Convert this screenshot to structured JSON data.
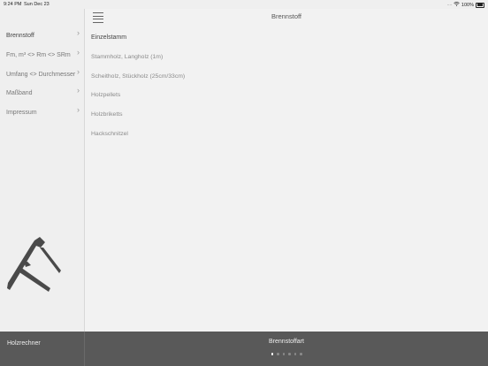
{
  "statusbar": {
    "time": "9:24 PM",
    "date": "Sun Dec 23",
    "battery": "100%",
    "icons": [
      "signal-icon",
      "wifi-icon",
      "battery-icon"
    ]
  },
  "sidebar": {
    "items": [
      {
        "label": "Brennstoff",
        "active": true
      },
      {
        "label": "Fm, m³ <> Rm <> SRm",
        "active": false
      },
      {
        "label": "Umfang <> Durchmesser",
        "active": false
      },
      {
        "label": "Maßband",
        "active": false
      },
      {
        "label": "Impressum",
        "active": false
      }
    ],
    "logo": "caliper-logo"
  },
  "main": {
    "title": "Brennstoff",
    "header": "Einzelstamm",
    "items": [
      "Stammholz, Langholz (1m)",
      "Scheitholz, Stückholz (25cm/33cm)",
      "Holzpellets",
      "Holzbriketts",
      "Hackschnitzel"
    ]
  },
  "footer": {
    "left_label": "Holzrechner",
    "center_label": "Brennstoffart",
    "page_count": 6,
    "active_page": 1
  },
  "colors": {
    "footer_bg": "#595959",
    "sidebar_bg": "#efefef",
    "main_bg": "#f2f2f2"
  }
}
